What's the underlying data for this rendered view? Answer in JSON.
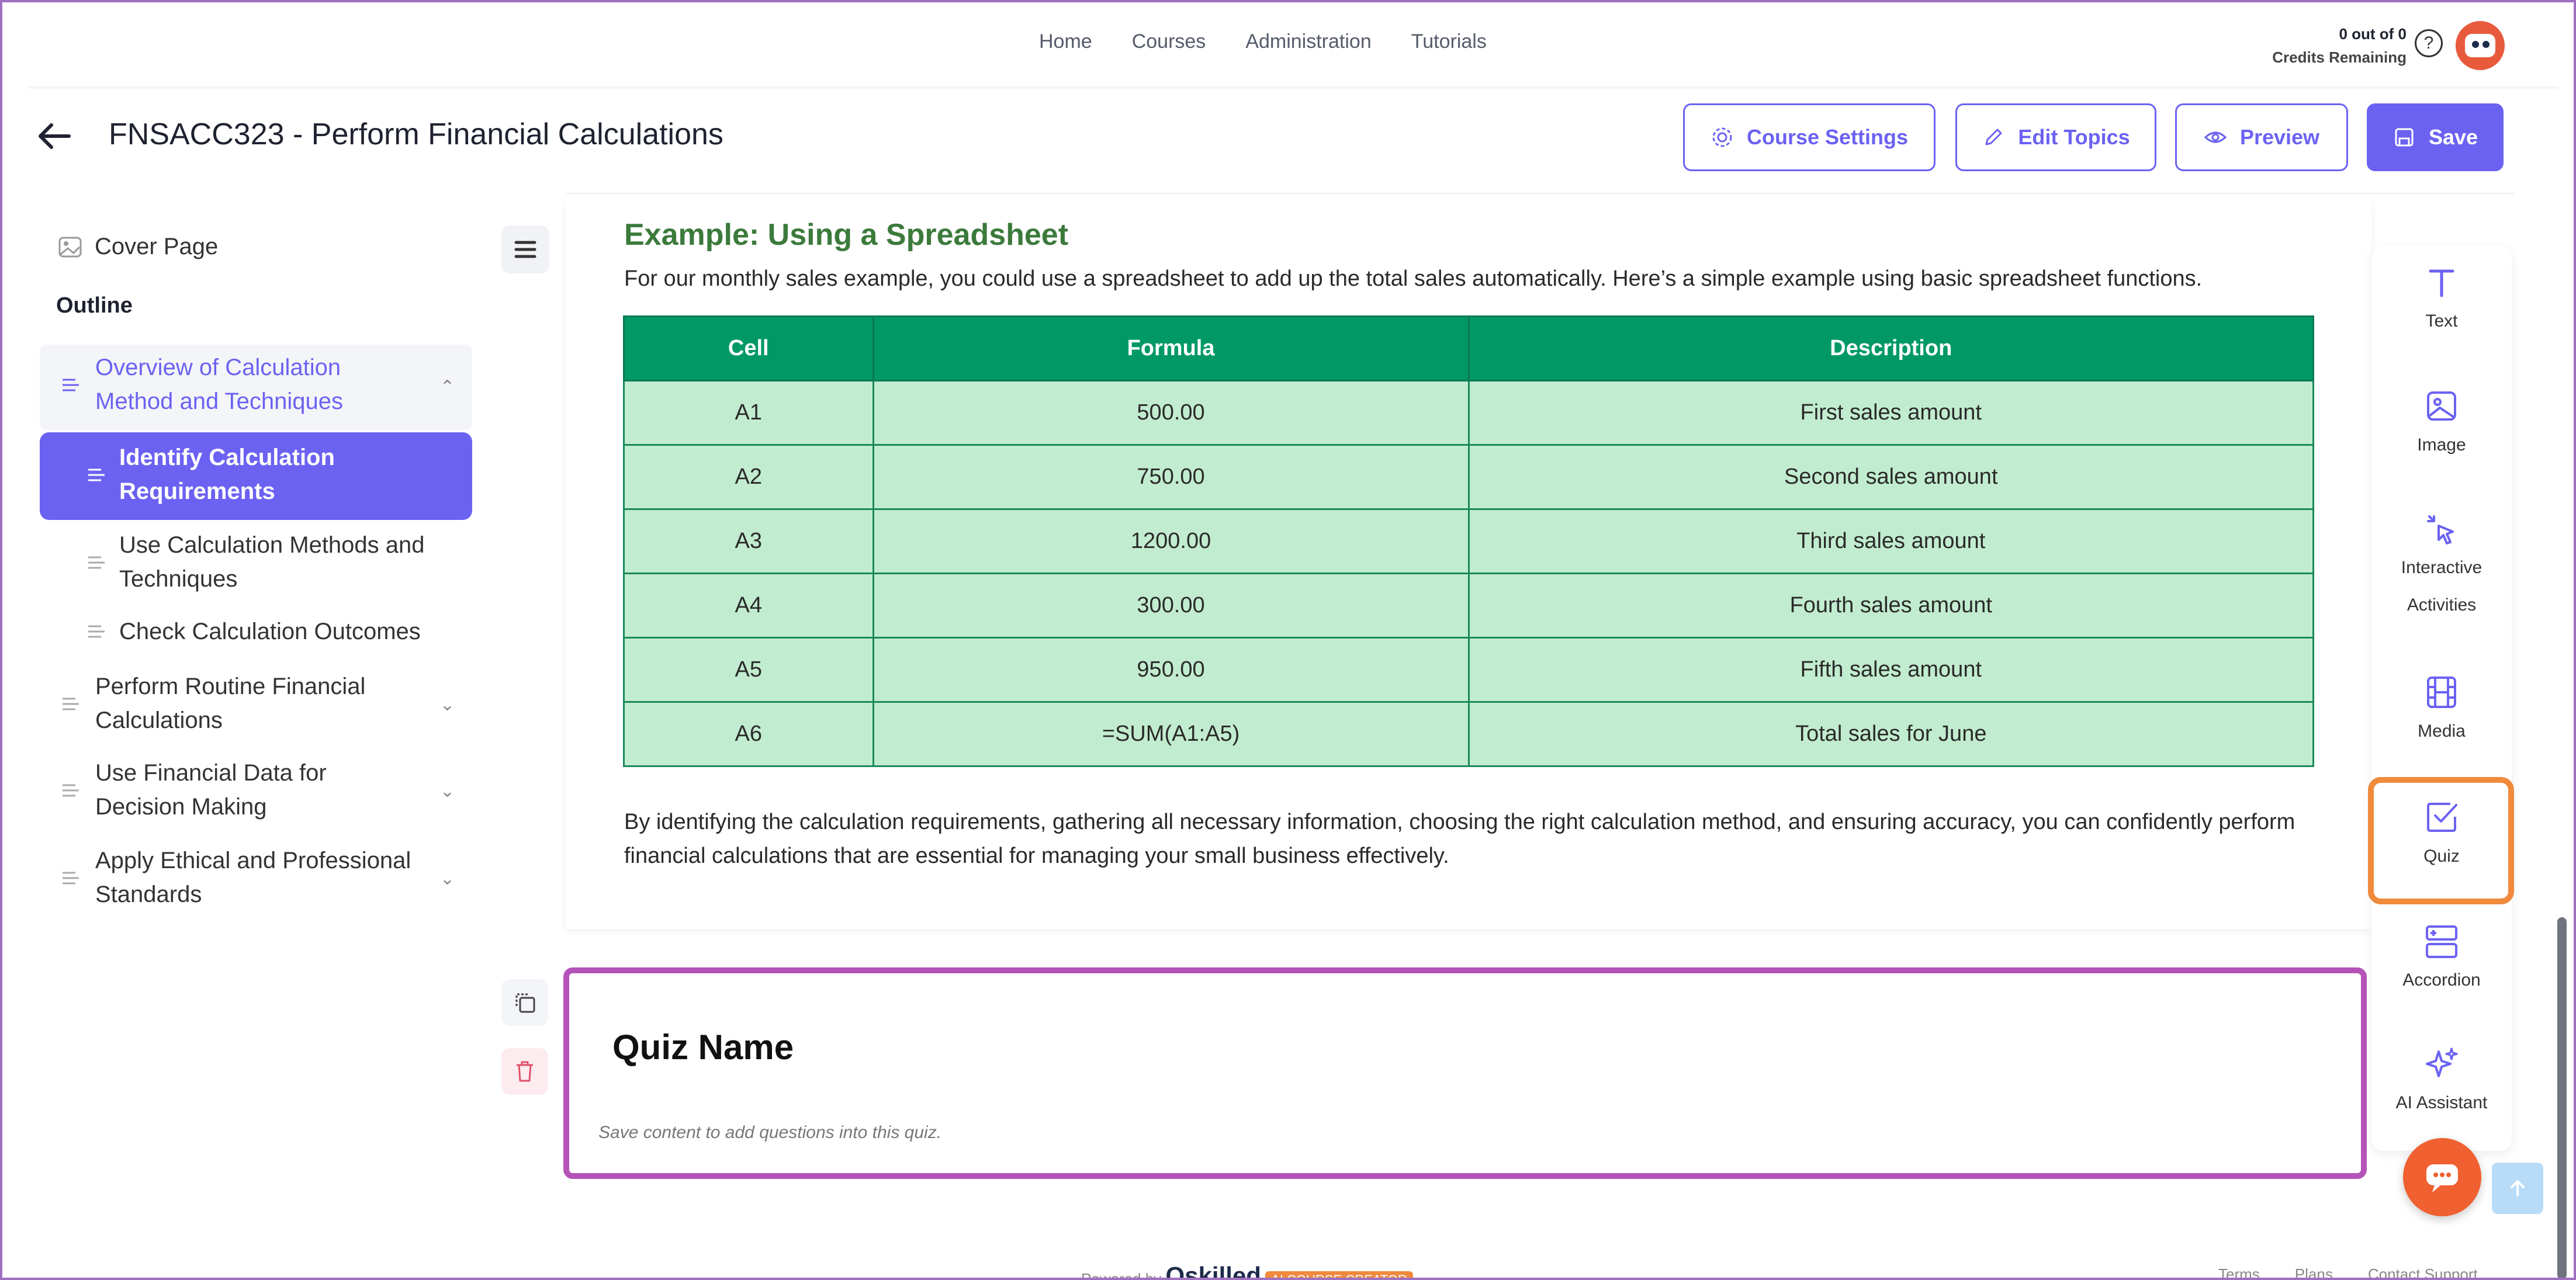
{
  "nav": {
    "links": [
      "Home",
      "Courses",
      "Administration",
      "Tutorials"
    ],
    "credits_line1": "0 out of 0",
    "credits_line2": "Credits Remaining",
    "help_glyph": "?"
  },
  "header": {
    "title": "FNSACC323 - Perform Financial Calculations",
    "course_settings": "Course Settings",
    "edit_topics": "Edit Topics",
    "preview": "Preview",
    "save": "Save"
  },
  "sidebar": {
    "cover_page": "Cover Page",
    "outline": "Outline",
    "items": [
      {
        "label_line1": "Overview of Calculation",
        "label_line2": "Method and Techniques",
        "chevron": "⌃"
      },
      {
        "label_line1": "Identify Calculation",
        "label_line2": "Requirements"
      },
      {
        "label_line1": "Use Calculation Methods and",
        "label_line2": "Techniques"
      },
      {
        "label_line1": "Check Calculation Outcomes"
      },
      {
        "label_line1": "Perform Routine Financial",
        "label_line2": "Calculations",
        "chevron": "⌄"
      },
      {
        "label_line1": "Use Financial Data for",
        "label_line2": "Decision Making",
        "chevron": "⌄"
      },
      {
        "label_line1": "Apply Ethical and Professional",
        "label_line2": "Standards",
        "chevron": "⌄"
      }
    ]
  },
  "content": {
    "example_title": "Example: Using a Spreadsheet",
    "example_text": "For our monthly sales example, you could use a spreadsheet to add up the total sales automatically. Here’s a simple example using basic spreadsheet functions.",
    "table": {
      "headers": [
        "Cell",
        "Formula",
        "Description"
      ],
      "rows": [
        [
          "A1",
          "500.00",
          "First sales amount"
        ],
        [
          "A2",
          "750.00",
          "Second sales amount"
        ],
        [
          "A3",
          "1200.00",
          "Third sales amount"
        ],
        [
          "A4",
          "300.00",
          "Fourth sales amount"
        ],
        [
          "A5",
          "950.00",
          "Fifth sales amount"
        ],
        [
          "A6",
          "=SUM(A1:A5)",
          "Total sales for June"
        ]
      ]
    },
    "closing_text": "By identifying the calculation requirements, gathering all necessary information, choosing the right calculation method, and ensuring accuracy, you can confidently perform financial calculations that are essential for managing your small business effectively."
  },
  "quiz": {
    "name": "Quiz Name",
    "hint": "Save content to add questions into this quiz."
  },
  "toolbar": {
    "text": "Text",
    "image": "Image",
    "interactive_line1": "Interactive",
    "interactive_line2": "Activities",
    "media": "Media",
    "quiz": "Quiz",
    "accordion": "Accordion",
    "ai_assistant": "AI Assistant"
  },
  "footer": {
    "powered_by": "Powered by",
    "brand": "Qskilled",
    "tag": "AI COURSE CREATOR",
    "links": [
      "Terms",
      "Plans",
      "Contact Support"
    ]
  },
  "colors": {
    "accent": "#6b62f2",
    "table_header": "#009966",
    "table_cell": "#c2eccf",
    "quiz_border": "#b554b8",
    "highlight": "#f08a3c"
  }
}
